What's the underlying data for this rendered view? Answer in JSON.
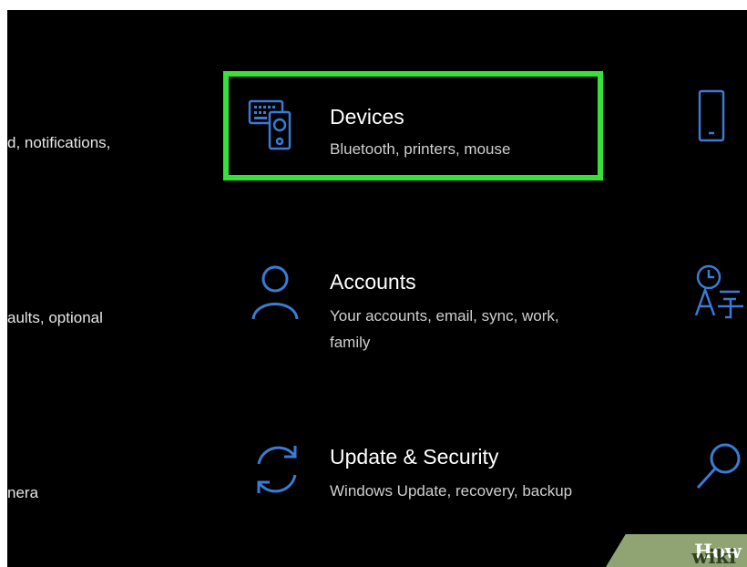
{
  "left_column": [
    {
      "text": "d, notifications,"
    },
    {
      "text": "aults, optional"
    },
    {
      "text": "nera"
    }
  ],
  "tiles": [
    {
      "icon": "devices-icon",
      "title": "Devices",
      "subtitle": "Bluetooth, printers, mouse",
      "highlighted": true
    },
    {
      "icon": "accounts-person-icon",
      "title": "Accounts",
      "subtitle": "Your accounts, email, sync, work, family",
      "highlighted": false
    },
    {
      "icon": "update-sync-icon",
      "title": "Update & Security",
      "subtitle": "Windows Update, recovery, backup",
      "highlighted": false
    }
  ],
  "right_column_icons": [
    "phone-icon",
    "time-language-icon",
    "search-icon"
  ],
  "watermark": {
    "part1": "wiki",
    "part2": "How"
  },
  "colors": {
    "background": "#000000",
    "accent_icon": "#3a7bd5",
    "highlight_border": "#37e13a",
    "title_text": "#ffffff",
    "subtitle_text": "#cfcfcf"
  }
}
